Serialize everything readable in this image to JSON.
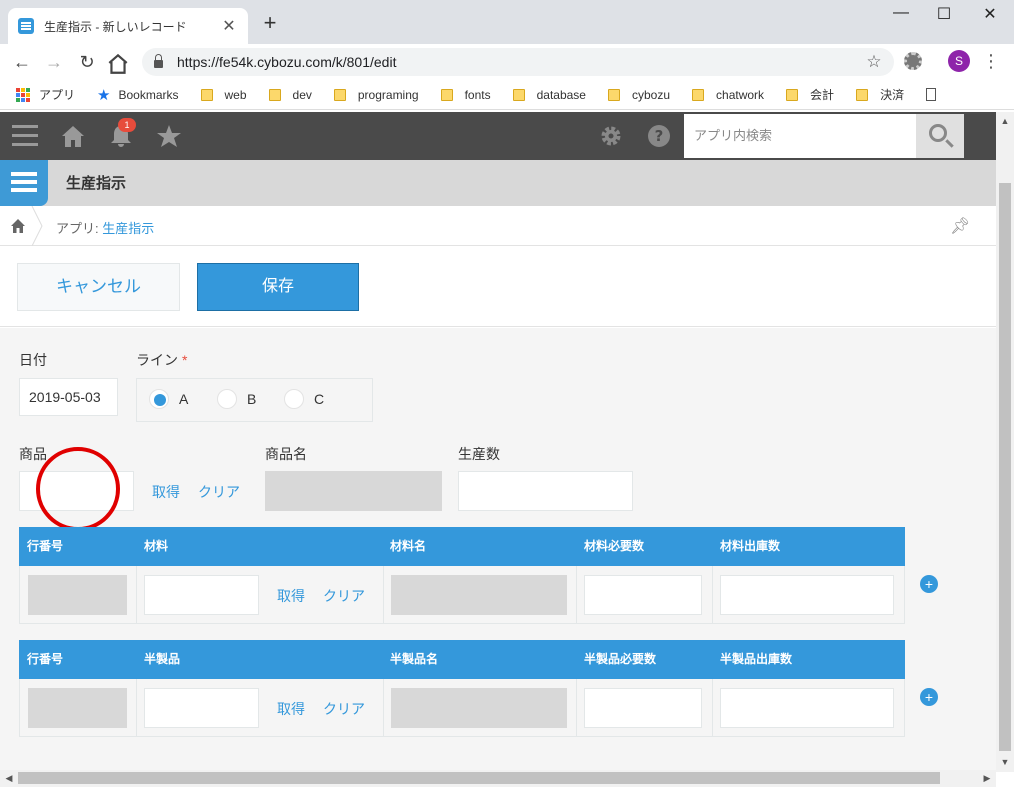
{
  "browser": {
    "tab_title": "生産指示 - 新しいレコード",
    "new_tab": "+",
    "url": "https://fe54k.cybozu.com/k/801/edit",
    "profile_initial": "S",
    "window_controls": [
      "—",
      "☐",
      "✕"
    ]
  },
  "bookmarks": [
    {
      "label": "アプリ",
      "icon": "apps-icon"
    },
    {
      "label": "Bookmarks",
      "icon": "star-icon"
    },
    {
      "label": "web",
      "icon": "folder-icon"
    },
    {
      "label": "dev",
      "icon": "folder-icon"
    },
    {
      "label": "programing",
      "icon": "folder-icon"
    },
    {
      "label": "fonts",
      "icon": "folder-icon"
    },
    {
      "label": "database",
      "icon": "folder-icon"
    },
    {
      "label": "cybozu",
      "icon": "folder-icon"
    },
    {
      "label": "chatwork",
      "icon": "folder-icon"
    },
    {
      "label": "会計",
      "icon": "folder-icon"
    },
    {
      "label": "決済",
      "icon": "folder-icon"
    }
  ],
  "header": {
    "notification_count": "1",
    "search_placeholder": "アプリ内検索"
  },
  "app": {
    "title": "生産指示",
    "breadcrumb_prefix": "アプリ:",
    "breadcrumb_link": "生産指示"
  },
  "actions": {
    "cancel": "キャンセル",
    "save": "保存"
  },
  "form": {
    "date_label": "日付",
    "date_value": "2019-05-03",
    "line_label": "ライン",
    "line_required_mark": "*",
    "line_options": [
      "A",
      "B",
      "C"
    ],
    "line_selected": "A",
    "product_label": "商品",
    "product_name_label": "商品名",
    "production_qty_label": "生産数",
    "fetch": "取得",
    "clear": "クリア"
  },
  "materials_table": {
    "headers": [
      "行番号",
      "材料",
      "材料名",
      "材料必要数",
      "材料出庫数"
    ],
    "fetch": "取得",
    "clear": "クリア"
  },
  "semi_table": {
    "headers": [
      "行番号",
      "半製品",
      "半製品名",
      "半製品必要数",
      "半製品出庫数"
    ],
    "fetch": "取得",
    "clear": "クリア"
  },
  "colors": {
    "accent": "#3498db",
    "header_bg": "#4a4a4a",
    "highlight_circle": "#e00000"
  }
}
